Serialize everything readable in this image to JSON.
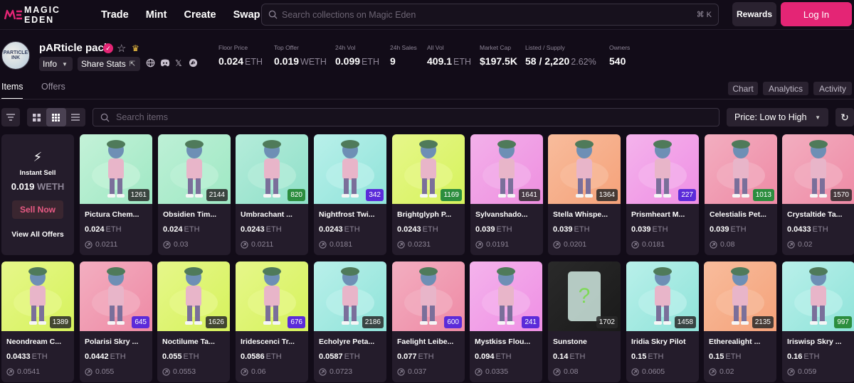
{
  "nav": {
    "brand": "MAGIC EDEN",
    "links": [
      "Trade",
      "Mint",
      "Create",
      "Swap"
    ],
    "search_placeholder": "Search collections on Magic Eden",
    "shortcut": "⌘ K",
    "rewards": "Rewards",
    "login": "Log In"
  },
  "collection": {
    "avatar_text": "PARTICLE INK",
    "name": "pARticle pack",
    "info_label": "Info",
    "share_label": "Share Stats",
    "stats": [
      {
        "label": "Floor Price",
        "value": "0.024",
        "unit": "ETH"
      },
      {
        "label": "Top Offer",
        "value": "0.019",
        "unit": "WETH"
      },
      {
        "label": "24h Vol",
        "value": "0.099",
        "unit": "ETH"
      },
      {
        "label": "24h Sales",
        "value": "9",
        "unit": ""
      },
      {
        "label": "All Vol",
        "value": "409.1",
        "unit": "ETH"
      },
      {
        "label": "Market Cap",
        "value": "$197.5K",
        "unit": ""
      },
      {
        "label": "Listed / Supply",
        "value": "58 / 2,220",
        "unit": "2.62%"
      },
      {
        "label": "Owners",
        "value": "540",
        "unit": ""
      }
    ]
  },
  "tabs": {
    "items": "Items",
    "offers": "Offers"
  },
  "right_tabs": [
    "Chart",
    "Analytics",
    "Activity"
  ],
  "toolbar": {
    "items_placeholder": "Search items",
    "sort": "Price: Low to High"
  },
  "instant_sell": {
    "label": "Instant Sell",
    "price": "0.019",
    "unit": "WETH",
    "button": "Sell Now",
    "view_all": "View All Offers"
  },
  "colors": {
    "accent": "#e42575",
    "background": "#120c18",
    "card": "#241c2b"
  },
  "items": [
    {
      "name": "Pictura Chem...",
      "price": "0.024",
      "unit": "ETH",
      "bid": "0.0211",
      "id": "1261",
      "badge": "gray",
      "bg": "#9fe8c4",
      "bg2": "#c4f2d8"
    },
    {
      "name": "Obsidien Tim...",
      "price": "0.024",
      "unit": "ETH",
      "bid": "0.03",
      "id": "2144",
      "badge": "gray",
      "bg": "#9fe8c4",
      "bg2": "#bdf0d6"
    },
    {
      "name": "Umbrachant ...",
      "price": "0.0243",
      "unit": "ETH",
      "bid": "0.0211",
      "id": "820",
      "badge": "green",
      "bg": "#8fe0c9",
      "bg2": "#b5ecda"
    },
    {
      "name": "Nightfrost Twi...",
      "price": "0.0243",
      "unit": "ETH",
      "bid": "0.0181",
      "id": "342",
      "badge": "purple",
      "bg": "#8fe3d9",
      "bg2": "#b9f0ea"
    },
    {
      "name": "Brightglyph P...",
      "price": "0.0243",
      "unit": "ETH",
      "bid": "0.0231",
      "id": "1169",
      "badge": "green",
      "bg": "#d6f25c",
      "bg2": "#e6f78a"
    },
    {
      "name": "Sylvanshado...",
      "price": "0.039",
      "unit": "ETH",
      "bid": "0.0191",
      "id": "1641",
      "badge": "gray",
      "bg": "#ee8fe0",
      "bg2": "#f3b0ea"
    },
    {
      "name": "Stella Whispe...",
      "price": "0.039",
      "unit": "ETH",
      "bid": "0.0201",
      "id": "1364",
      "badge": "gray",
      "bg": "#f5a27a",
      "bg2": "#f8bc9c"
    },
    {
      "name": "Prismheart M...",
      "price": "0.039",
      "unit": "ETH",
      "bid": "0.0181",
      "id": "227",
      "badge": "purple",
      "bg": "#ef8fe4",
      "bg2": "#f4b3ec"
    },
    {
      "name": "Celestialis Pet...",
      "price": "0.039",
      "unit": "ETH",
      "bid": "0.08",
      "id": "1013",
      "badge": "green",
      "bg": "#ee8aa5",
      "bg2": "#f3aec0"
    },
    {
      "name": "Crystaltide Ta...",
      "price": "0.0433",
      "unit": "ETH",
      "bid": "0.02",
      "id": "1570",
      "badge": "gray",
      "bg": "#ee8aa5",
      "bg2": "#f3aec0"
    },
    {
      "name": "Neondream C...",
      "price": "0.0433",
      "unit": "ETH",
      "bid": "0.0541",
      "id": "1389",
      "badge": "gray",
      "bg": "#d6f25c",
      "bg2": "#e6f78a"
    },
    {
      "name": "Polarisi Skry ...",
      "price": "0.0442",
      "unit": "ETH",
      "bid": "0.055",
      "id": "645",
      "badge": "purple",
      "bg": "#ee8aa5",
      "bg2": "#f3aec0"
    },
    {
      "name": "Noctilume Ta...",
      "price": "0.055",
      "unit": "ETH",
      "bid": "0.0553",
      "id": "1626",
      "badge": "gray",
      "bg": "#d6f25c",
      "bg2": "#e6f78a"
    },
    {
      "name": "Iridescenci Tr...",
      "price": "0.0586",
      "unit": "ETH",
      "bid": "0.06",
      "id": "676",
      "badge": "purple",
      "bg": "#d6f25c",
      "bg2": "#e6f78a"
    },
    {
      "name": "Echolyre Peta...",
      "price": "0.0587",
      "unit": "ETH",
      "bid": "0.0723",
      "id": "2186",
      "badge": "gray",
      "bg": "#8fe3d9",
      "bg2": "#b9f0ea"
    },
    {
      "name": "Faelight Leibe...",
      "price": "0.077",
      "unit": "ETH",
      "bid": "0.037",
      "id": "600",
      "badge": "purple",
      "bg": "#ee8aa5",
      "bg2": "#f3aec0"
    },
    {
      "name": "Mystkiss Flou...",
      "price": "0.094",
      "unit": "ETH",
      "bid": "0.0335",
      "id": "241",
      "badge": "purple",
      "bg": "#ef8fe4",
      "bg2": "#f4b3ec"
    },
    {
      "name": "Sunstone",
      "price": "0.14",
      "unit": "ETH",
      "bid": "0.08",
      "id": "1702",
      "badge": "gray",
      "bg": "#1a1a1a",
      "bg2": "#2a2a2a"
    },
    {
      "name": "Iridia Skry Pilot",
      "price": "0.15",
      "unit": "ETH",
      "bid": "0.0605",
      "id": "1458",
      "badge": "gray",
      "bg": "#8fe3d9",
      "bg2": "#b9f0ea"
    },
    {
      "name": "Etherealight ...",
      "price": "0.15",
      "unit": "ETH",
      "bid": "0.02",
      "id": "2135",
      "badge": "gray",
      "bg": "#f5a27a",
      "bg2": "#f8bc9c"
    },
    {
      "name": "Iriswisp Skry ...",
      "price": "0.16",
      "unit": "ETH",
      "bid": "0.059",
      "id": "997",
      "badge": "green",
      "bg": "#8fe3d9",
      "bg2": "#b9f0ea"
    }
  ]
}
